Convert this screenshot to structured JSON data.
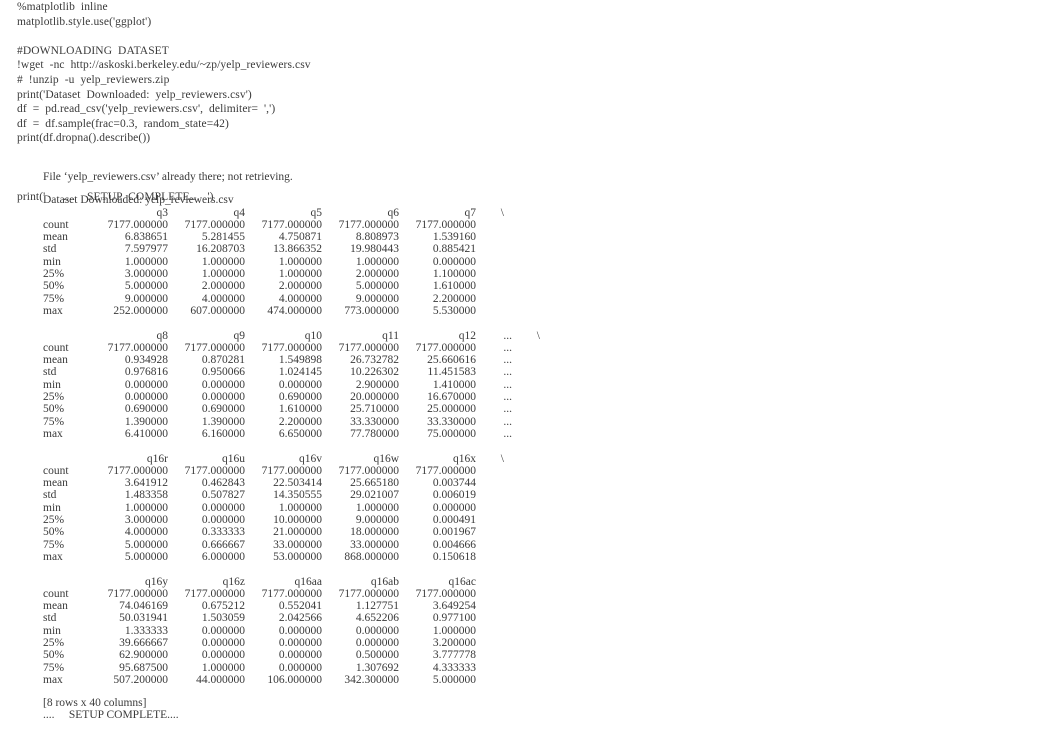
{
  "cell": {
    "source_lines": [
      "%matplotlib  inline",
      "matplotlib.style.use('ggplot')",
      "",
      "#DOWNLOADING  DATASET",
      "!wget  -nc  http://askoski.berkeley.edu/~zp/yelp_reviewers.csv",
      "#  !unzip  -u  yelp_reviewers.zip",
      "print('Dataset  Downloaded:  yelp_reviewers.csv')",
      "df  =  pd.read_csv('yelp_reviewers.csv',  delimiter=  ',')",
      "df  =  df.sample(frac=0.3,  random_state=42)",
      "print(df.dropna().describe())",
      "",
      "print('      ....    SETUP  COMPLETE..    ')"
    ]
  },
  "output": {
    "wget_message": "File ‘yelp_reviewers.csv’ already there; not retrieving.",
    "download_message": "Dataset Downloaded: yelp_reviewers.csv",
    "footer_shape": "[8 rows x 40 columns]",
    "footer_status": "....     SETUP COMPLETE...."
  },
  "dataframe": {
    "index": [
      "count",
      "mean",
      "std",
      "min",
      "25%",
      "50%",
      "75%",
      "max"
    ],
    "continuation_marker": "\\",
    "ellipsis_marker": "...",
    "blocks": [
      {
        "columns": [
          "q3",
          "q4",
          "q5",
          "q6",
          "q7"
        ],
        "has_ellipsis_column": false,
        "has_continuation": true,
        "rows": [
          [
            "7177.000000",
            "7177.000000",
            "7177.000000",
            "7177.000000",
            "7177.000000"
          ],
          [
            "6.838651",
            "5.281455",
            "4.750871",
            "8.808973",
            "1.539160"
          ],
          [
            "7.597977",
            "16.208703",
            "13.866352",
            "19.980443",
            "0.885421"
          ],
          [
            "1.000000",
            "1.000000",
            "1.000000",
            "1.000000",
            "0.000000"
          ],
          [
            "3.000000",
            "1.000000",
            "1.000000",
            "2.000000",
            "1.100000"
          ],
          [
            "5.000000",
            "2.000000",
            "2.000000",
            "5.000000",
            "1.610000"
          ],
          [
            "9.000000",
            "4.000000",
            "4.000000",
            "9.000000",
            "2.200000"
          ],
          [
            "252.000000",
            "607.000000",
            "474.000000",
            "773.000000",
            "5.530000"
          ]
        ]
      },
      {
        "columns": [
          "q8",
          "q9",
          "q10",
          "q11",
          "q12"
        ],
        "has_ellipsis_column": true,
        "has_continuation": true,
        "rows": [
          [
            "7177.000000",
            "7177.000000",
            "7177.000000",
            "7177.000000",
            "7177.000000"
          ],
          [
            "0.934928",
            "0.870281",
            "1.549898",
            "26.732782",
            "25.660616"
          ],
          [
            "0.976816",
            "0.950066",
            "1.024145",
            "10.226302",
            "11.451583"
          ],
          [
            "0.000000",
            "0.000000",
            "0.000000",
            "2.900000",
            "1.410000"
          ],
          [
            "0.000000",
            "0.000000",
            "0.690000",
            "20.000000",
            "16.670000"
          ],
          [
            "0.690000",
            "0.690000",
            "1.610000",
            "25.710000",
            "25.000000"
          ],
          [
            "1.390000",
            "1.390000",
            "2.200000",
            "33.330000",
            "33.330000"
          ],
          [
            "6.410000",
            "6.160000",
            "6.650000",
            "77.780000",
            "75.000000"
          ]
        ]
      },
      {
        "columns": [
          "q16r",
          "q16u",
          "q16v",
          "q16w",
          "q16x"
        ],
        "has_ellipsis_column": false,
        "has_continuation": true,
        "rows": [
          [
            "7177.000000",
            "7177.000000",
            "7177.000000",
            "7177.000000",
            "7177.000000"
          ],
          [
            "3.641912",
            "0.462843",
            "22.503414",
            "25.665180",
            "0.003744"
          ],
          [
            "1.483358",
            "0.507827",
            "14.350555",
            "29.021007",
            "0.006019"
          ],
          [
            "1.000000",
            "0.000000",
            "1.000000",
            "1.000000",
            "0.000000"
          ],
          [
            "3.000000",
            "0.000000",
            "10.000000",
            "9.000000",
            "0.000491"
          ],
          [
            "4.000000",
            "0.333333",
            "21.000000",
            "18.000000",
            "0.001967"
          ],
          [
            "5.000000",
            "0.666667",
            "33.000000",
            "33.000000",
            "0.004666"
          ],
          [
            "5.000000",
            "6.000000",
            "53.000000",
            "868.000000",
            "0.150618"
          ]
        ]
      },
      {
        "columns": [
          "q16y",
          "q16z",
          "q16aa",
          "q16ab",
          "q16ac"
        ],
        "has_ellipsis_column": false,
        "has_continuation": false,
        "rows": [
          [
            "7177.000000",
            "7177.000000",
            "7177.000000",
            "7177.000000",
            "7177.000000"
          ],
          [
            "74.046169",
            "0.675212",
            "0.552041",
            "1.127751",
            "3.649254"
          ],
          [
            "50.031941",
            "1.503059",
            "2.042566",
            "4.652206",
            "0.977100"
          ],
          [
            "1.333333",
            "0.000000",
            "0.000000",
            "0.000000",
            "1.000000"
          ],
          [
            "39.666667",
            "0.000000",
            "0.000000",
            "0.000000",
            "3.200000"
          ],
          [
            "62.900000",
            "0.000000",
            "0.000000",
            "0.500000",
            "3.777778"
          ],
          [
            "95.687500",
            "1.000000",
            "0.000000",
            "1.307692",
            "4.333333"
          ],
          [
            "507.200000",
            "44.000000",
            "106.000000",
            "342.300000",
            "5.000000"
          ]
        ]
      }
    ]
  }
}
